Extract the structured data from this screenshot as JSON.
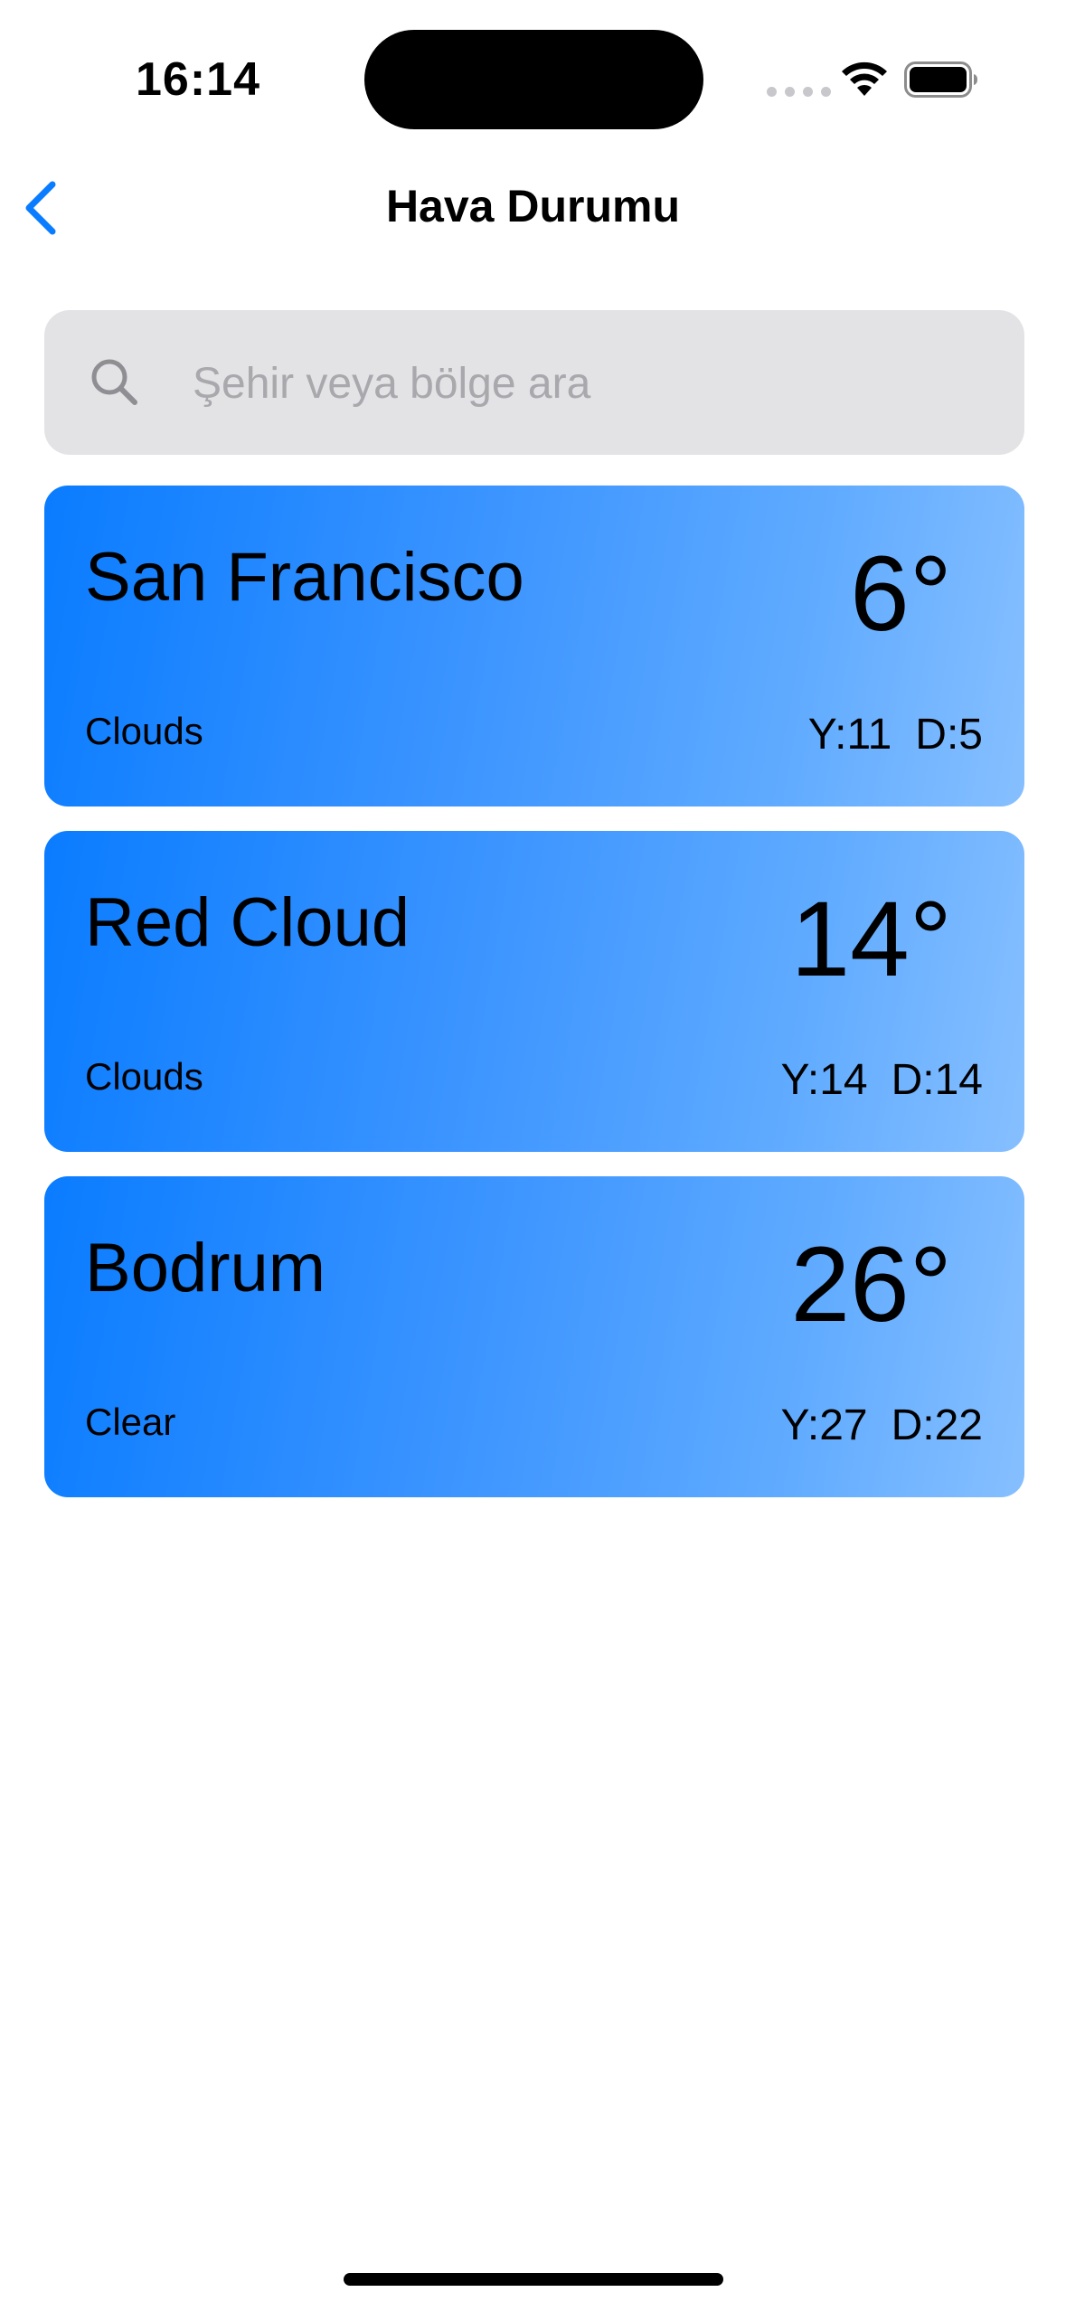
{
  "status_bar": {
    "time": "16:14"
  },
  "nav": {
    "title": "Hava Durumu",
    "back_icon": "chevron-left-icon",
    "accent": "#0a7cff"
  },
  "search": {
    "placeholder": "Şehir veya bölge ara",
    "value": "",
    "icon": "search-icon"
  },
  "cities": [
    {
      "name": "San Francisco",
      "temp": "6°",
      "condition": "Clouds",
      "high": "Y:11",
      "low": "D:5"
    },
    {
      "name": "Red Cloud",
      "temp": "14°",
      "condition": "Clouds",
      "high": "Y:14",
      "low": "D:14"
    },
    {
      "name": "Bodrum",
      "temp": "26°",
      "condition": "Clear",
      "high": "Y:27",
      "low": "D:22"
    }
  ]
}
